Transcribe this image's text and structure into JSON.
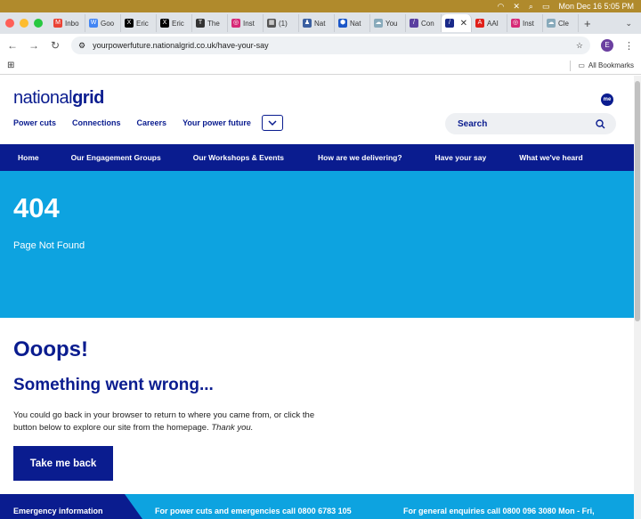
{
  "menubar": {
    "datetime": "Mon Dec 16  5:05 PM"
  },
  "tabs": [
    {
      "label": "Inbo",
      "icon": "gmail-icon",
      "color": "#ea4335"
    },
    {
      "label": "Goo",
      "icon": "google-doc-icon",
      "color": "#4285f4"
    },
    {
      "label": "Eric",
      "icon": "x-icon",
      "color": "#000000"
    },
    {
      "label": "Eric",
      "icon": "x-icon",
      "color": "#000000"
    },
    {
      "label": "The",
      "icon": "nyt-icon",
      "color": "#333333"
    },
    {
      "label": "Inst",
      "icon": "instagram-icon",
      "color": "#d62976"
    },
    {
      "label": "(1)",
      "icon": "page-icon",
      "color": "#555555"
    },
    {
      "label": "Nat",
      "icon": "person-icon",
      "color": "#3a5fa0"
    },
    {
      "label": "Nat",
      "icon": "hex-icon",
      "color": "#1a56c8"
    },
    {
      "label": "You",
      "icon": "cloud-icon",
      "color": "#8ab"
    },
    {
      "label": "Con",
      "icon": "stripe-icon",
      "color": "#5a3fa0"
    },
    {
      "label": "AAI",
      "icon": "red-a-icon",
      "color": "#e0201a"
    },
    {
      "label": "Inst",
      "icon": "instagram-icon",
      "color": "#d62976"
    },
    {
      "label": "Cle",
      "icon": "cloud-icon",
      "color": "#8ab"
    }
  ],
  "address": {
    "url": "yourpowerfuture.nationalgrid.co.uk/have-your-say",
    "profile_initial": "E"
  },
  "bookmarks": {
    "all_label": "All Bookmarks"
  },
  "site": {
    "logo_light": "national",
    "logo_bold": "grid",
    "me_badge": "me",
    "topnav": [
      "Power cuts",
      "Connections",
      "Careers",
      "Your power future"
    ],
    "search_label": "Search",
    "mainnav": [
      "Home",
      "Our Engagement Groups",
      "Our Workshops & Events",
      "How are we delivering?",
      "Have your say",
      "What we've heard"
    ]
  },
  "hero": {
    "code": "404",
    "subtitle": "Page Not Found"
  },
  "content": {
    "oops": "Ooops!",
    "wrong": "Something went wrong...",
    "para_main": "You could go back in your browser to return to where you came from, or click the button below to explore our site from the homepage.",
    "para_thanks": "Thank you.",
    "button": "Take me back"
  },
  "footer": {
    "emergency": "Emergency information",
    "power_cuts": "For power cuts and emergencies call 0800 6783 105",
    "enquiries": "For general enquiries call 0800 096 3080 Mon - Fri,"
  },
  "colors": {
    "brand_navy": "#0a1c8f",
    "hero_blue": "#0da3e0"
  }
}
